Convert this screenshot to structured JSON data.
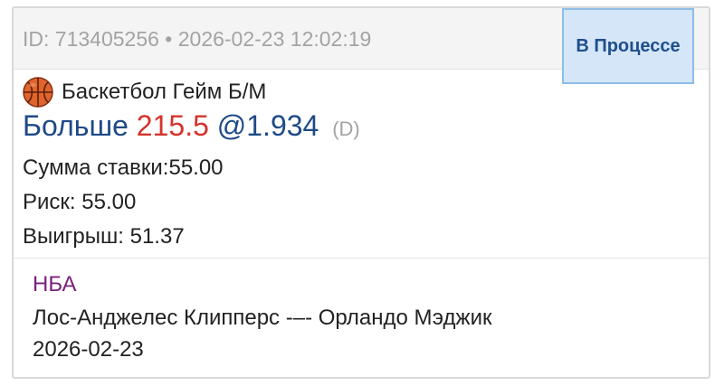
{
  "header": {
    "meta": "ID: 713405256 • 2026-02-23 12:02:19",
    "status": "В Процессе"
  },
  "bet": {
    "sport_icon": "basketball-icon",
    "sport_name": "Баскетбол Гейм Б/М",
    "selection": "Больше",
    "line": "215.5",
    "odds": "@1.934",
    "odds_type": "(D)",
    "stake": "Сумма ставки:55.00",
    "risk": "Риск: 55.00",
    "win": "Выигрыш: 51.37"
  },
  "event": {
    "league": "НБА",
    "match": "Лос-Анджелес Клипперс -–- Орландо Мэджик",
    "date": "2026-02-23"
  },
  "colors": {
    "header_bg": "#f4f4f4",
    "status_bg": "#d4e6f8",
    "status_border": "#8fbde6",
    "status_text": "#1f4e8c",
    "selection_blue": "#1f4a87",
    "line_red": "#d4332c",
    "league_purple": "#7b1f7d",
    "muted_gray": "#a3a3a3"
  }
}
